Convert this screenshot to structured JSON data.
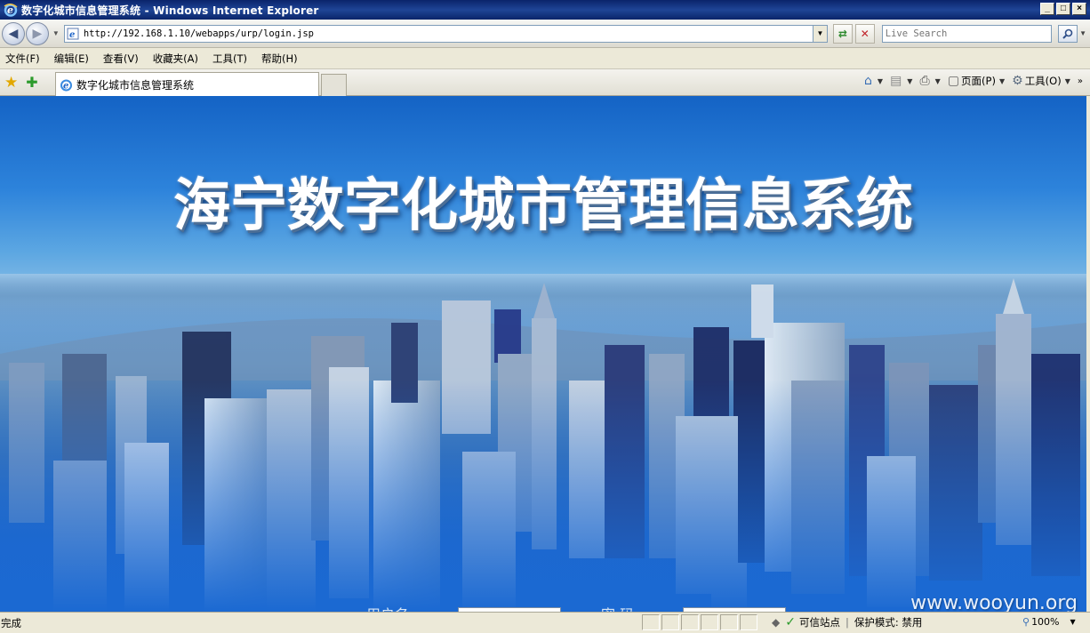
{
  "window": {
    "title": "数字化城市信息管理系统 - Windows Internet Explorer",
    "buttons": [
      "_",
      "□",
      "×"
    ]
  },
  "addressbar": {
    "url": "http://192.168.1.10/webapps/urp/login.jsp",
    "search_placeholder": "Live Search"
  },
  "menubar": {
    "items": [
      "文件(F)",
      "编辑(E)",
      "查看(V)",
      "收藏夹(A)",
      "工具(T)",
      "帮助(H)"
    ]
  },
  "tabs": [
    {
      "label": "数字化城市信息管理系统",
      "active": true
    }
  ],
  "commandbar": {
    "page_label": "页面(P)",
    "tools_label": "工具(O)"
  },
  "content": {
    "banner_title": "海宁数字化城市管理信息系统",
    "login": {
      "username_label": "用户名",
      "password_label": "密 码"
    },
    "watermark": "www.wooyun.org"
  },
  "statusbar": {
    "status": "完成",
    "zone": "可信站点",
    "protected_mode": "保护模式: 禁用",
    "zoom": "100%"
  },
  "colors": {
    "titlebar": "#0a246a",
    "content_sky_top": "#1463c5",
    "content_bottom": "#1b69d2",
    "chrome": "#ece9d8"
  }
}
